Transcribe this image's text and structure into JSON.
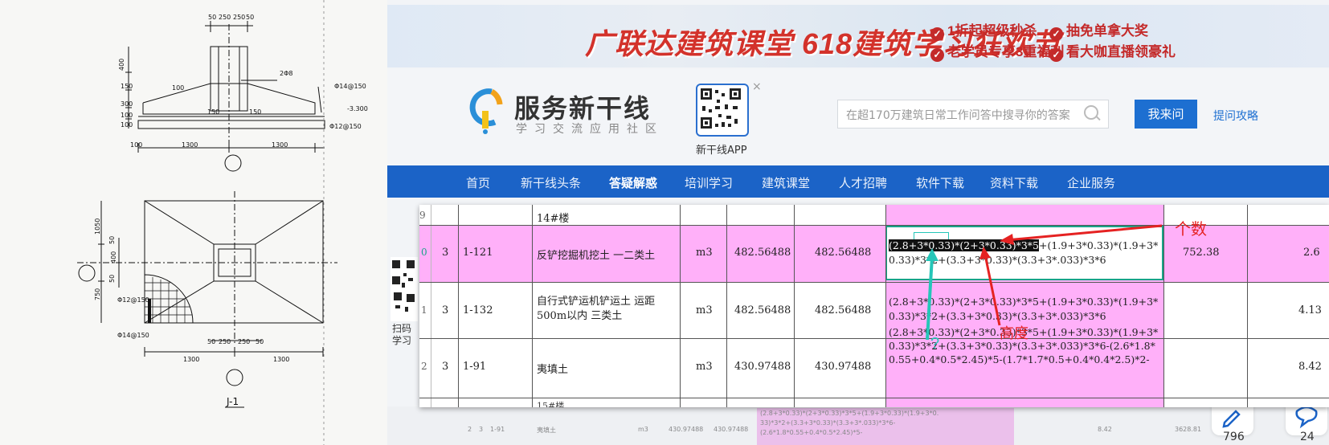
{
  "drawing": {
    "top_dims": [
      "50",
      "250",
      "250",
      "50"
    ],
    "elev_dims": [
      "400",
      "150",
      "300",
      "100",
      "100"
    ],
    "side_notes": [
      "100",
      "2Φ8",
      "Φ14@150",
      "-3.300",
      "Φ12@150"
    ],
    "bottom_dims": [
      "100",
      "1300",
      "1300"
    ],
    "plan_side_dims": [
      "1050",
      "50",
      "400",
      "50",
      "750"
    ],
    "plan_notes": [
      "Φ12@150",
      "Φ14@150"
    ],
    "plan_top_dims": [
      "50",
      "250",
      "250",
      "50"
    ],
    "plan_bottom_dims": [
      "1300",
      "1300"
    ],
    "elev_inner_dims": [
      "150",
      "150"
    ],
    "label": "J-1"
  },
  "banner": {
    "title": "广联达建筑课堂 618建筑学习狂欢节",
    "perks": [
      "1折起超级秒杀",
      "抽免单拿大奖",
      "老学员专享3重福利",
      "看大咖直播领豪礼"
    ]
  },
  "header": {
    "logo_name": "服务新干线",
    "logo_slogan": "学习交流应用社区",
    "qr_label": "新干线APP",
    "qr_close": "×",
    "search_placeholder": "在超170万建筑日常工作问答中搜寻你的答案",
    "ask_button": "我来问",
    "ask_tips": "提问攻略"
  },
  "nav": {
    "items": [
      "首页",
      "新干线头条",
      "答疑解惑",
      "培训学习",
      "建筑课堂",
      "人才招聘",
      "软件下载",
      "资料下载",
      "企业服务"
    ],
    "active_index": 2
  },
  "side": {
    "qr_label": "扫码\n学习"
  },
  "sheet": {
    "section_header": "14#楼",
    "next_section": "15#楼",
    "rows": [
      {
        "rownum": "9",
        "a": "",
        "code": "",
        "name": "14#楼",
        "unit": "",
        "q1": "",
        "q2": "",
        "formula": "",
        "total": "",
        "extra": ""
      },
      {
        "rownum": "0",
        "a": "3",
        "code": "1-121",
        "name": "反铲挖掘机挖土 一二类土",
        "unit": "m3",
        "q1": "482.56488",
        "q2": "482.56488",
        "formula_hl": "(2.8+3*0.33)*(2+3*0.33)*3*5",
        "formula_rest": "+(1.9+3*0.33)*(1.9+3*0.33)*3*2+(3.3+3*0.33)*(3.3+3*.033)*3*6",
        "total": "752.38",
        "extra": "2.6"
      },
      {
        "rownum": "1",
        "a": "3",
        "code": "1-132",
        "name": "自行式铲运机铲运土 运距500m以内 三类土",
        "unit": "m3",
        "q1": "482.56488",
        "q2": "482.56488",
        "formula": "(2.8+3*0.33)*(2+3*0.33)*3*5+(1.9+3*0.33)*(1.9+3*0.33)*3*2+(3.3+3*0.33)*(3.3+3*.033)*3*6",
        "total": "",
        "extra": "4.13"
      },
      {
        "rownum": "2",
        "a": "3",
        "code": "1-91",
        "name": "夷填土",
        "unit": "m3",
        "q1": "430.97488",
        "q2": "430.97488",
        "formula": "(2.8+3*0.33)*(2+3*0.33)*3*5+(1.9+3*0.33)*(1.9+3*0.33)*3*2+(3.3+3*0.33)*(3.3+3*.033)*3*6-(2.6*1.8*0.55+0.4*0.5*2.45)*5-(1.7*1.7*0.5+0.4*0.4*2.5)*2-",
        "total": "",
        "extra": "8.42"
      }
    ]
  },
  "annotations": {
    "count": "个数",
    "height": "高度",
    "question": "?"
  },
  "background_table": {
    "row": [
      "2",
      "3",
      "1-91",
      "夷填土",
      "m3",
      "430.97488",
      "430.97488",
      "8.42",
      "3628.81"
    ],
    "formula_lines": [
      "(2.8+3*0.33)*(2+3*0.33)*3*5+(1.9+3*0.33)*(1.9+3*0.",
      "33)*3*2+(3.3+3*0.33)*(3.3+3*.033)*3*6-",
      "(2.6*1.8*0.55+0.4*0.5*2.45)*5-"
    ]
  },
  "right_stats": [
    "796",
    "24"
  ]
}
